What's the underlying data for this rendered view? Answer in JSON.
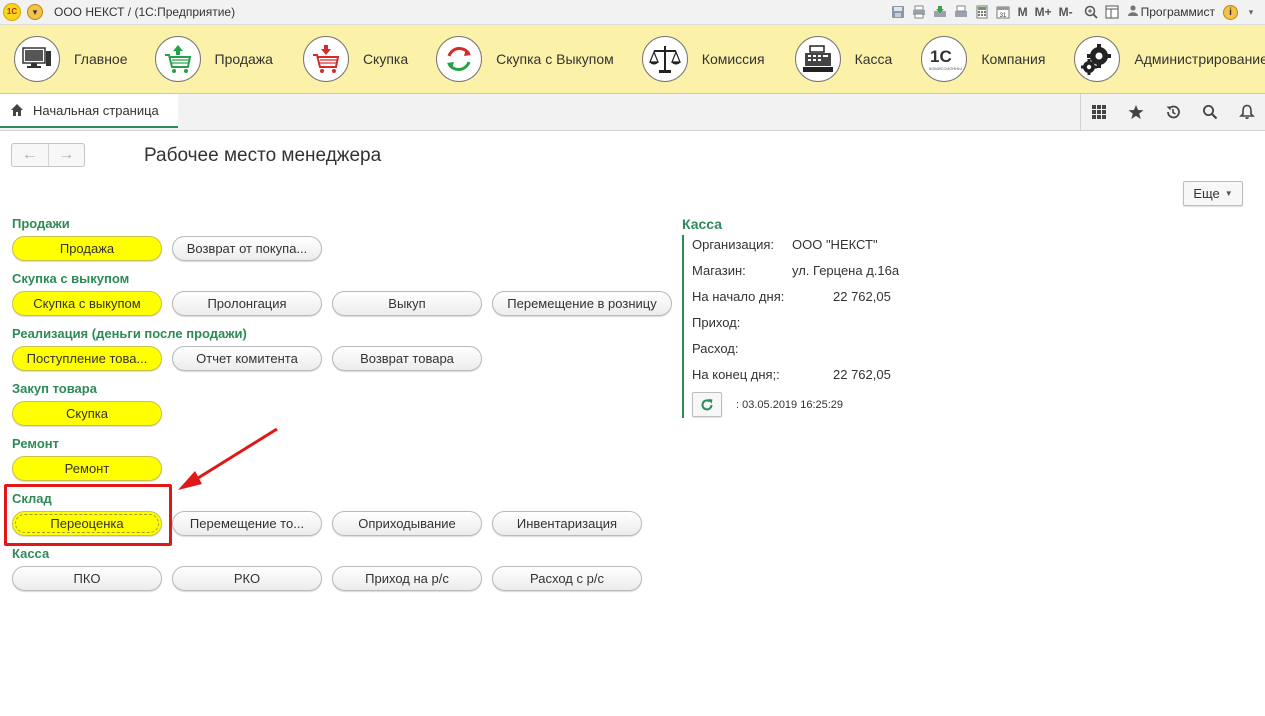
{
  "titlebar": {
    "logo": "1С",
    "title": "ООО НЕКСТ /   (1С:Предприятие)",
    "icons": [
      "save-icon",
      "print-icon",
      "export-icon",
      "print-preview-icon",
      "calculator-icon",
      "calendar-icon"
    ],
    "m_labels": [
      "M",
      "M+",
      "M-"
    ],
    "user": "Программист",
    "info": "i"
  },
  "sections": [
    {
      "label": "Главное",
      "icon": "monitor-icon"
    },
    {
      "label": "Продажа",
      "icon": "cart-up-icon"
    },
    {
      "label": "Скупка",
      "icon": "cart-down-icon"
    },
    {
      "label": "Скупка с Выкупом",
      "icon": "cycle-arrows-icon"
    },
    {
      "label": "Комиссия",
      "icon": "scales-icon"
    },
    {
      "label": "Касса",
      "icon": "cash-register-icon"
    },
    {
      "label": "Компания",
      "icon": "company-1c-icon"
    },
    {
      "label": "Администрирование",
      "icon": "gears-icon"
    }
  ],
  "tabbar": {
    "home_tab": "Начальная страница",
    "tools": [
      "apps-grid-icon",
      "star-icon",
      "history-icon",
      "search-icon",
      "bell-icon"
    ]
  },
  "page": {
    "title": "Рабочее место менеджера",
    "more_button": "Еще"
  },
  "groups": [
    {
      "title": "Продажи",
      "buttons": [
        "Продажа",
        "Возврат от покупа..."
      ]
    },
    {
      "title": "Скупка с выкупом",
      "buttons": [
        "Скупка с выкупом",
        "Пролонгация",
        "Выкуп",
        "Перемещение в розницу"
      ]
    },
    {
      "title": "Реализация (деньги после продажи)",
      "buttons": [
        "Поступление това...",
        "Отчет комитента",
        "Возврат товара"
      ]
    },
    {
      "title": "Закуп товара",
      "buttons": [
        "Скупка"
      ]
    },
    {
      "title": "Ремонт",
      "buttons": [
        "Ремонт"
      ]
    },
    {
      "title": "Склад",
      "buttons": [
        "Переоценка",
        "Перемещение то...",
        "Оприходывание",
        "Инвентаризация"
      ]
    },
    {
      "title": "Касса",
      "buttons": [
        "ПКО",
        "РКО",
        "Приход на р/с",
        "Расход с р/с"
      ]
    }
  ],
  "kassa": {
    "title": "Касса",
    "org_label": "Организация:",
    "org_value": "ООО \"НЕКСТ\"",
    "shop_label": "Магазин:",
    "shop_value": "ул. Герцена д.16а",
    "start_label": "На начало дня:",
    "start_value": "22 762,05",
    "income_label": "Приход:",
    "expense_label": "Расход:",
    "end_label": "На конец дня;:",
    "end_value": "22 762,05",
    "refresh_info": ":  03.05.2019 16:25:29"
  },
  "colors": {
    "sections_bg": "#fbf1a9",
    "accent_green": "#2e8b57",
    "button_yellow": "#ffff00",
    "annotation_red": "#e01818"
  }
}
